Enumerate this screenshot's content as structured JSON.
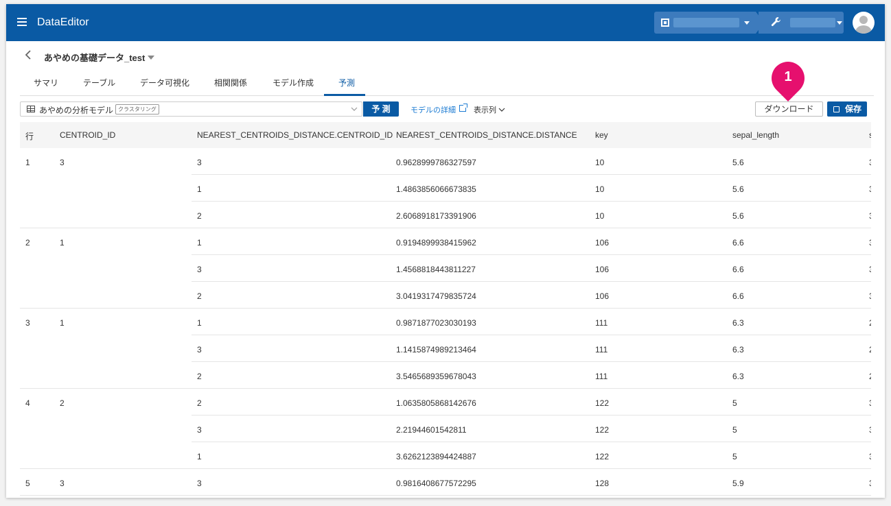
{
  "header": {
    "app_title": "DataEditor",
    "menu_icon": "hamburger-menu-icon",
    "org_icon": "building-icon",
    "tool_icon": "wrench-icon",
    "avatar_icon": "user-avatar-icon"
  },
  "breadcrumb": {
    "back_icon": "chevron-left-icon",
    "title": "あやめの基礎データ_test"
  },
  "tabs": [
    {
      "label": "サマリ"
    },
    {
      "label": "テーブル"
    },
    {
      "label": "データ可視化"
    },
    {
      "label": "相関関係"
    },
    {
      "label": "モデル作成"
    },
    {
      "label": "予測",
      "active": true
    }
  ],
  "toolbar": {
    "model_name": "あやめの分析モデル",
    "model_type_badge": "クラスタリング",
    "predict_label": "予 測",
    "model_detail_label": "モデルの詳細",
    "columns_label": "表示列",
    "download_label": "ダウンロード",
    "save_label": "保存",
    "callout_number": "1"
  },
  "table": {
    "columns": [
      "行",
      "CENTROID_ID",
      "NEAREST_CENTROIDS_DISTANCE.CENTROID_ID",
      "NEAREST_CENTROIDS_DISTANCE.DISTANCE",
      "key",
      "sepal_length",
      "s"
    ],
    "rows": [
      {
        "row": "1",
        "centroid": "3",
        "ncd_id": "3",
        "distance": "0.9628999786327597",
        "key": "10",
        "sepal_length": "5.6",
        "s": "3"
      },
      {
        "row": "",
        "centroid": "",
        "ncd_id": "1",
        "distance": "1.4863856066673835",
        "key": "10",
        "sepal_length": "5.6",
        "s": "3"
      },
      {
        "row": "",
        "centroid": "",
        "ncd_id": "2",
        "distance": "2.6068918173391906",
        "key": "10",
        "sepal_length": "5.6",
        "s": "3"
      },
      {
        "row": "2",
        "centroid": "1",
        "ncd_id": "1",
        "distance": "0.9194899938415962",
        "key": "106",
        "sepal_length": "6.6",
        "s": "3"
      },
      {
        "row": "",
        "centroid": "",
        "ncd_id": "3",
        "distance": "1.4568818443811227",
        "key": "106",
        "sepal_length": "6.6",
        "s": "3"
      },
      {
        "row": "",
        "centroid": "",
        "ncd_id": "2",
        "distance": "3.0419317479835724",
        "key": "106",
        "sepal_length": "6.6",
        "s": "3"
      },
      {
        "row": "3",
        "centroid": "1",
        "ncd_id": "1",
        "distance": "0.9871877023030193",
        "key": "111",
        "sepal_length": "6.3",
        "s": "2"
      },
      {
        "row": "",
        "centroid": "",
        "ncd_id": "3",
        "distance": "1.1415874989213464",
        "key": "111",
        "sepal_length": "6.3",
        "s": "2"
      },
      {
        "row": "",
        "centroid": "",
        "ncd_id": "2",
        "distance": "3.5465689359678043",
        "key": "111",
        "sepal_length": "6.3",
        "s": "2"
      },
      {
        "row": "4",
        "centroid": "2",
        "ncd_id": "2",
        "distance": "1.0635805868142676",
        "key": "122",
        "sepal_length": "5",
        "s": "3"
      },
      {
        "row": "",
        "centroid": "",
        "ncd_id": "3",
        "distance": "2.21944601542811",
        "key": "122",
        "sepal_length": "5",
        "s": "3"
      },
      {
        "row": "",
        "centroid": "",
        "ncd_id": "1",
        "distance": "3.6262123894424887",
        "key": "122",
        "sepal_length": "5",
        "s": "3"
      },
      {
        "row": "5",
        "centroid": "3",
        "ncd_id": "3",
        "distance": "0.9816408677572295",
        "key": "128",
        "sepal_length": "5.9",
        "s": "3"
      }
    ]
  },
  "colors": {
    "brand": "#0a5aa4",
    "link": "#1a7ad2",
    "callout": "#e6106e"
  }
}
